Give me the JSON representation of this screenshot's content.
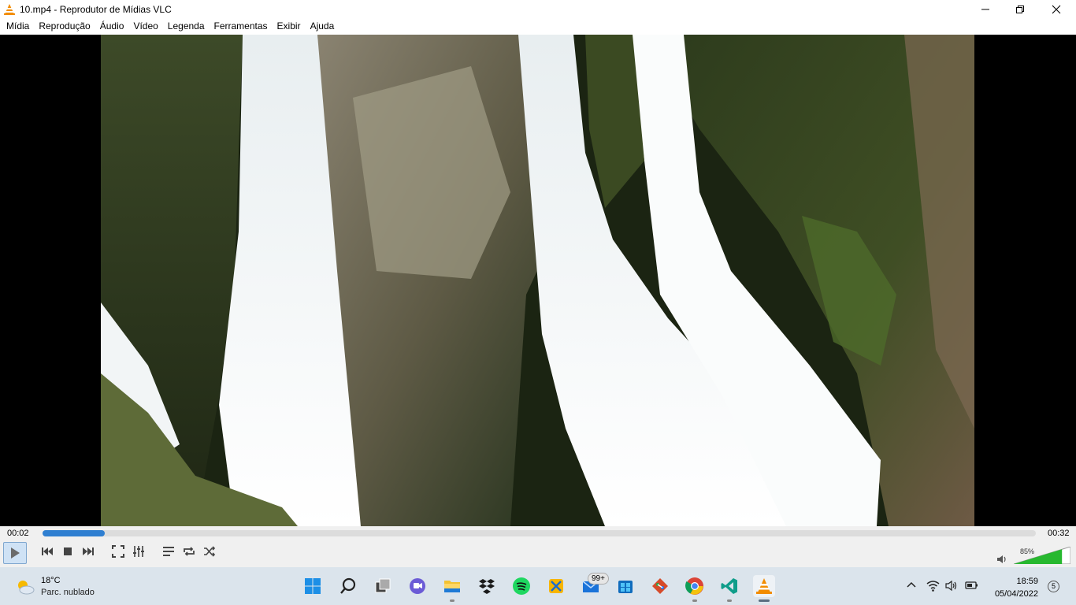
{
  "window": {
    "title": "10.mp4 - Reprodutor de Mídias VLC"
  },
  "menu": {
    "items": [
      {
        "label": "Mídia"
      },
      {
        "label": "Reprodução"
      },
      {
        "label": "Áudio"
      },
      {
        "label": "Vídeo"
      },
      {
        "label": "Legenda"
      },
      {
        "label": "Ferramentas"
      },
      {
        "label": "Exibir"
      },
      {
        "label": "Ajuda"
      }
    ]
  },
  "player": {
    "elapsed": "00:02",
    "total": "00:32",
    "progress_fraction": 0.0625,
    "volume_label": "85%",
    "volume_fraction": 0.85,
    "accent_color": "#2f7fd1",
    "volume_color": "#27b82f"
  },
  "taskbar": {
    "weather_temp": "18°C",
    "weather_desc": "Parc. nublado",
    "mail_badge": "99+",
    "time": "18:59",
    "date": "05/04/2022",
    "notifications": "5"
  }
}
